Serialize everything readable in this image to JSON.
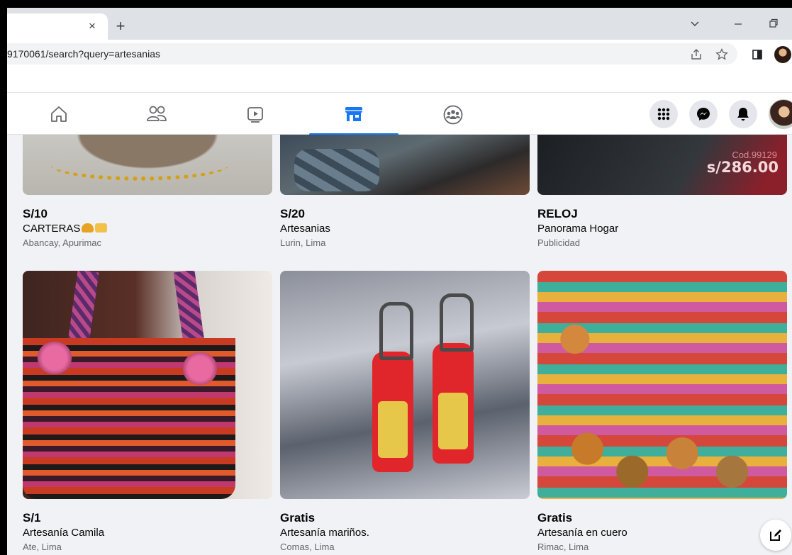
{
  "browser": {
    "tab_close_glyph": "×",
    "new_tab_glyph": "+",
    "url": "9170061/search?query=artesanias"
  },
  "colors": {
    "fb_blue": "#1877f2",
    "page_bg": "#f0f2f5",
    "secondary_text": "#65676b"
  },
  "fbnav": {
    "tabs": [
      {
        "name": "home",
        "icon": "home-icon",
        "active": false
      },
      {
        "name": "friends",
        "icon": "friends-icon",
        "active": false
      },
      {
        "name": "watch",
        "icon": "video-icon",
        "active": false
      },
      {
        "name": "marketplace",
        "icon": "marketplace-icon",
        "active": true
      },
      {
        "name": "groups",
        "icon": "groups-icon",
        "active": false
      }
    ],
    "right": [
      "menu-grid-icon",
      "messenger-icon",
      "notifications-icon",
      "profile-avatar"
    ]
  },
  "listings": [
    {
      "price": "S/10",
      "title": "CARTERAS",
      "location": "Abancay, Apurimac"
    },
    {
      "price": "S/20",
      "title": "Artesanias",
      "location": "Lurin, Lima"
    },
    {
      "price": "RELOJ",
      "title": "Panorama Hogar",
      "location": "Publicidad",
      "photo_text": {
        "code": "Cod.99129",
        "price": "s/286.00"
      }
    },
    {
      "price": "S/1",
      "title": "Artesanía Camila",
      "location": "Ate, Lima"
    },
    {
      "price": "Gratis",
      "title": "Artesanía mariños.",
      "location": "Comas, Lima"
    },
    {
      "price": "Gratis",
      "title": "Artesanía en cuero",
      "location": "Rimac, Lima"
    }
  ]
}
